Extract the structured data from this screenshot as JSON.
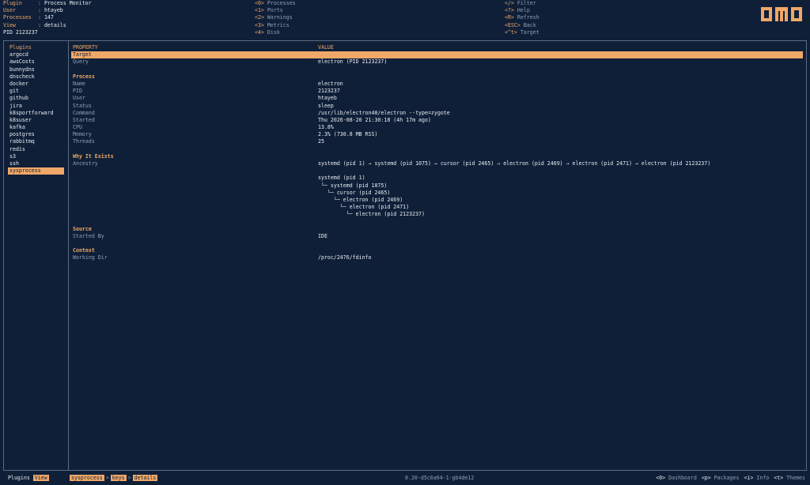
{
  "header": {
    "info": [
      {
        "label": "Plugin",
        "value": "Process Monitor"
      },
      {
        "label": "User",
        "value": "htayeb"
      },
      {
        "label": "Processes",
        "value": "147"
      },
      {
        "label": "View",
        "value": "details"
      }
    ],
    "pid_line": "PID 2123237",
    "keys_col1": [
      {
        "key": "<0>",
        "label": "Processes"
      },
      {
        "key": "<1>",
        "label": "Ports"
      },
      {
        "key": "<2>",
        "label": "Warnings"
      },
      {
        "key": "<3>",
        "label": "Metrics"
      },
      {
        "key": "<4>",
        "label": "Disk"
      }
    ],
    "keys_col2": [
      {
        "key": "</>",
        "label": "Filter"
      },
      {
        "key": "<?>",
        "label": "Help"
      },
      {
        "key": "<R>",
        "label": "Refresh"
      },
      {
        "key": "<ESC>",
        "label": "Back"
      },
      {
        "key": "<^t>",
        "label": "Target"
      }
    ],
    "logo": "OMO"
  },
  "sidebar": {
    "items": [
      "Plugins",
      "argocd",
      "awsCosts",
      "bunnydns",
      "dnscheck",
      "docker",
      "git",
      "github",
      "jira",
      "k8sportforward",
      "k8suser",
      "kafka",
      "postgres",
      "rabbitmq",
      "redis",
      "s3",
      "ssh",
      "sysprocess"
    ],
    "selected": "sysprocess"
  },
  "table": {
    "col_property": "PROPERTY",
    "col_value": "VALUE",
    "rows": [
      {
        "type": "selected",
        "prop": "Target",
        "val": ""
      },
      {
        "type": "row",
        "prop": "Query",
        "val": "electron (PID 2123237)"
      },
      {
        "type": "blank",
        "prop": "",
        "val": ""
      },
      {
        "type": "section",
        "prop": "Process",
        "val": ""
      },
      {
        "type": "row",
        "prop": "Name",
        "val": "electron"
      },
      {
        "type": "row",
        "prop": "PID",
        "val": "2123237"
      },
      {
        "type": "row",
        "prop": "User",
        "val": "htayeb"
      },
      {
        "type": "row",
        "prop": "Status",
        "val": "sleep"
      },
      {
        "type": "row",
        "prop": "Command",
        "val": "/usr/lib/electron40/electron --type=zygote"
      },
      {
        "type": "row",
        "prop": "Started",
        "val": "Thu 2026-08-20 21:30:18 (4h 17m ago)"
      },
      {
        "type": "row",
        "prop": "CPU",
        "val": "13.8%"
      },
      {
        "type": "row",
        "prop": "Memory",
        "val": "2.3% (730.8 MB RSS)"
      },
      {
        "type": "row",
        "prop": "Threads",
        "val": "25"
      },
      {
        "type": "blank",
        "prop": "",
        "val": ""
      },
      {
        "type": "section",
        "prop": "Why It Exists",
        "val": ""
      },
      {
        "type": "row",
        "prop": "Ancestry",
        "val": "systemd (pid 1) → systemd (pid 1075) → cursor (pid 2465) → electron (pid 2469) → electron (pid 2471) → electron (pid 2123237)"
      },
      {
        "type": "blank",
        "prop": "",
        "val": ""
      },
      {
        "type": "row",
        "prop": "",
        "val": "systemd (pid 1)"
      },
      {
        "type": "row",
        "prop": "",
        "val": " └─ systemd (pid 1075)"
      },
      {
        "type": "row",
        "prop": "",
        "val": "   └─ cursor (pid 2465)"
      },
      {
        "type": "row",
        "prop": "",
        "val": "     └─ electron (pid 2469)"
      },
      {
        "type": "row",
        "prop": "",
        "val": "       └─ electron (pid 2471)"
      },
      {
        "type": "row",
        "prop": "",
        "val": "         └─ electron (pid 2123237)"
      },
      {
        "type": "blank",
        "prop": "",
        "val": ""
      },
      {
        "type": "section",
        "prop": "Source",
        "val": ""
      },
      {
        "type": "row",
        "prop": "Started By",
        "val": "IDE"
      },
      {
        "type": "blank",
        "prop": "",
        "val": ""
      },
      {
        "type": "section",
        "prop": "Context",
        "val": ""
      },
      {
        "type": "row",
        "prop": "Working Dir",
        "val": "/proc/2476/fdinfo"
      }
    ]
  },
  "footer": {
    "plugins_label": "Plugins",
    "view_tag": "View",
    "crumbs": [
      "sysprocess",
      "keys",
      "details"
    ],
    "version": "0.20-d5c6a64-1-gb4de12",
    "shortcuts": [
      {
        "key": "<0>",
        "label": "Dashboard"
      },
      {
        "key": "<p>",
        "label": "Packages"
      },
      {
        "key": "<i>",
        "label": "Info"
      },
      {
        "key": "<t>",
        "label": "Themes"
      }
    ]
  },
  "colors": {
    "background": "#0f1f38",
    "accent": "#f0a868",
    "text": "#c9d2dc"
  }
}
